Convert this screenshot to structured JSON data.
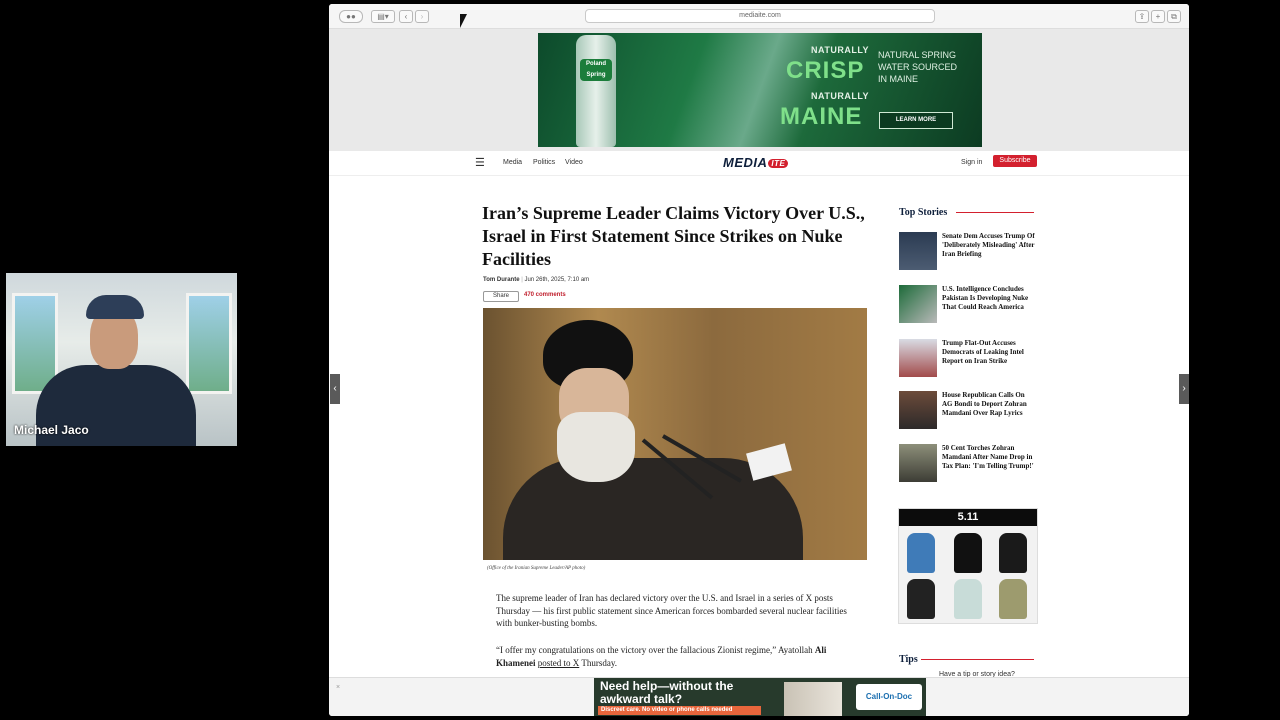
{
  "webcam": {
    "name": "Michael Jaco"
  },
  "browser": {
    "url": "mediaite.com",
    "tab_icon": "sidebar-icon",
    "back_icon": "chevron-left-icon",
    "forward_icon": "chevron-right-icon"
  },
  "top_ad": {
    "brand": "Poland Spring",
    "line1_small": "NATURALLY",
    "line1_big": "CRISP",
    "line2_small": "NATURALLY",
    "line2_big": "MAINE",
    "tagline": "NATURAL SPRING WATER SOURCED IN MAINE",
    "cta": "LEARN MORE"
  },
  "site_nav": {
    "links": [
      "Media",
      "Politics",
      "Video"
    ],
    "logo": "MEDIA",
    "logo_suffix": "ITE",
    "signin": "Sign in",
    "subscribe": "Subscribe",
    "accent": "#d3202e"
  },
  "article": {
    "headline": "Iran’s Supreme Leader Claims Victory Over U.S., Israel in First Statement Since Strikes on Nuke Facilities",
    "author": "Tom Durante",
    "date": "Jun 26th, 2025, 7:10 am",
    "share": "Share",
    "comments": "470 comments",
    "caption": "(Office of the Iranian Supreme Leader/AP photo)",
    "para1": "The supreme leader of Iran has declared victory over the U.S. and Israel in a series of X posts Thursday — his first public statement since American forces bombarded several nuclear facilities with bunker-busting bombs.",
    "para2_a": "“I offer my congratulations on the victory over the fallacious Zionist regime,” Ayatollah ",
    "para2_name": "Ali Khamenei",
    "para2_link": "posted to X",
    "para2_b": " Thursday."
  },
  "sidebar": {
    "heading": "Top Stories",
    "stories": [
      "Senate Dem Accuses Trump Of 'Deliberately Misleading' After Iran Briefing",
      "U.S. Intelligence Concludes Pakistan Is Developing Nuke That Could Reach America",
      "Trump Flat-Out Accuses Democrats of Leaking Intel Report on Iran Strike",
      "House Republican Calls On AG Bondi to Deport Zohran Mamdani Over Rap Lyrics",
      "50 Cent Torches Zohran Mamdani After Name Drop in Tax Plan: 'I'm Telling Trump!'"
    ],
    "ad_brand": "5.11",
    "tips_heading": "Tips",
    "tips_text": "Have a tip or story idea?"
  },
  "bottom_ad": {
    "headline": "Need help—without the awkward talk?",
    "subline": "Discreet care. No video or phone calls needed",
    "brand": "Call-On-Doc"
  }
}
